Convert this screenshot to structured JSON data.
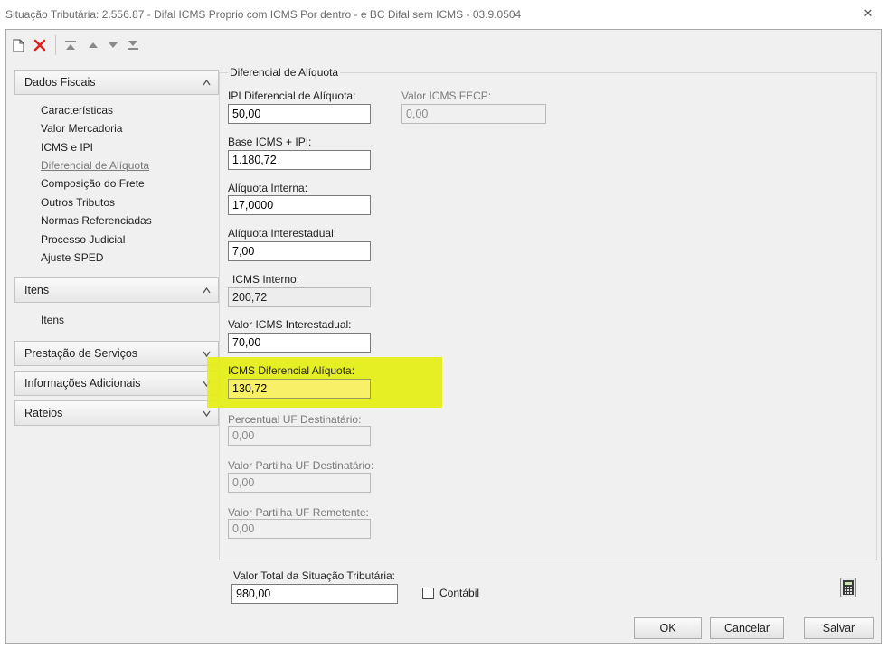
{
  "window": {
    "title": "Situação Tributária: 2.556.87 - Difal ICMS Proprio com ICMS Por dentro - e BC Difal sem ICMS - 03.9.0504",
    "close_glyph": "✕"
  },
  "toolbar": {
    "new_glyph": "🗋",
    "delete_glyph": "✕",
    "first_glyph": "⊼",
    "up_glyph": "▲",
    "down_glyph": "▼",
    "last_glyph": "⊻"
  },
  "sidebar": {
    "groups": [
      {
        "label": "Dados Fiscais",
        "chevron": "^",
        "items": [
          "Características",
          "Valor Mercadoria",
          "ICMS e IPI",
          "Diferencial de Alíquota",
          "Composição do Frete",
          "Outros Tributos",
          "Normas Referenciadas",
          "Processo Judicial",
          "Ajuste SPED"
        ]
      },
      {
        "label": "Itens",
        "chevron": "^",
        "items": [
          "Itens"
        ]
      },
      {
        "label": "Prestação de Serviços",
        "chevron": "v"
      },
      {
        "label": "Informações Adicionais",
        "chevron": "v"
      },
      {
        "label": "Rateios",
        "chevron": "v"
      }
    ]
  },
  "section": {
    "title": "Diferencial de Alíquota"
  },
  "fields": {
    "ipi_dif_aliquota": {
      "label": "IPI Diferencial de Alíquota:",
      "value": "50,00"
    },
    "valor_icms_fecp": {
      "label": "Valor ICMS FECP:",
      "value": "0,00"
    },
    "base_icms_ipi": {
      "label": "Base ICMS + IPI:",
      "value": "1.180,72"
    },
    "aliquota_interna": {
      "label": "Alíquota Interna:",
      "value": "17,0000"
    },
    "aliquota_interestadual": {
      "label": "Alíquota Interestadual:",
      "value": "7,00"
    },
    "icms_interno": {
      "label": "ICMS Interno:",
      "value": "200,72"
    },
    "valor_icms_interestadual": {
      "label": "Valor ICMS Interestadual:",
      "value": "70,00"
    },
    "icms_dif_aliquota": {
      "label": "ICMS Diferencial Alíquota:",
      "value": "130,72"
    },
    "percentual_uf_dest": {
      "label": "Percentual UF Destinatário:",
      "value": "0,00"
    },
    "valor_partilha_uf_dest": {
      "label": "Valor Partilha UF Destinatário:",
      "value": "0,00"
    },
    "valor_partilha_uf_rem": {
      "label": "Valor Partilha UF Remetente:",
      "value": "0,00"
    }
  },
  "footer": {
    "total_label": "Valor Total da Situação Tributária:",
    "total_value": "980,00",
    "contabil_label": "Contábil",
    "contabil_checked": false,
    "ok_label": "OK",
    "cancel_label": "Cancelar",
    "save_label": "Salvar"
  },
  "colors": {
    "highlight": "#e5ee12",
    "delete_red": "#e02020"
  }
}
